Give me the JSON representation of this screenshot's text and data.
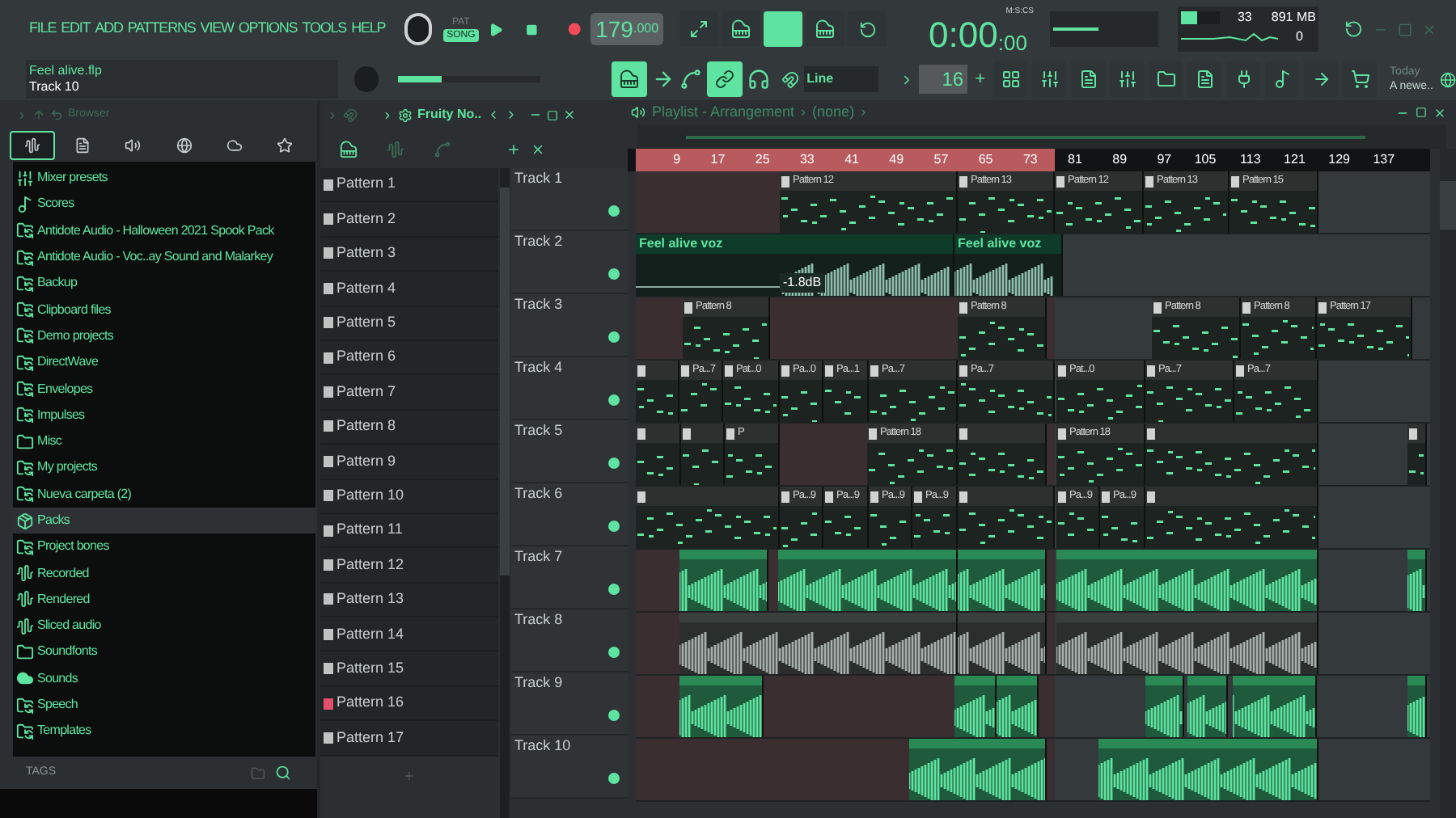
{
  "menu": [
    "FILE",
    "EDIT",
    "ADD",
    "PATTERNS",
    "VIEW",
    "OPTIONS",
    "TOOLS",
    "HELP"
  ],
  "hint": {
    "file": "Feel alive.flp",
    "target": "Track 10"
  },
  "transport": {
    "modes": [
      {
        "label": "PAT",
        "selected": false
      },
      {
        "label": "SONG",
        "selected": true
      }
    ],
    "recording": true,
    "tempo": "179",
    "tempo_fraction": ".000"
  },
  "clock": {
    "time": "0:00",
    "centis": ":00",
    "format": "M:S:CS"
  },
  "monitor": {
    "cpu": "33",
    "memory": "891 MB",
    "polyphony": "0",
    "level": 0.45
  },
  "master_volume": {
    "level": 0.3
  },
  "snap": {
    "value": "Line"
  },
  "step": {
    "value": "16",
    "plus": "+"
  },
  "news": {
    "date": "Today",
    "headline": "A newe.."
  },
  "browser": {
    "title": "Browser",
    "tabs": [
      {
        "selected": true
      },
      {
        "selected": false
      },
      {
        "selected": false
      },
      {
        "selected": false
      },
      {
        "selected": false
      },
      {
        "selected": false
      }
    ],
    "items": [
      {
        "label": "Mixer presets",
        "kind": "mixer",
        "selected": false
      },
      {
        "label": "Scores",
        "kind": "note",
        "selected": false
      },
      {
        "label": "Antidote Audio - Halloween 2021 Spook Pack",
        "kind": "folder",
        "selected": false
      },
      {
        "label": "Antidote Audio - Voc..ay Sound and Malarkey",
        "kind": "folder",
        "selected": false
      },
      {
        "label": "Backup",
        "kind": "folder",
        "selected": false
      },
      {
        "label": "Clipboard files",
        "kind": "folder",
        "selected": false
      },
      {
        "label": "Demo projects",
        "kind": "folder",
        "selected": false
      },
      {
        "label": "DirectWave",
        "kind": "folder",
        "selected": false
      },
      {
        "label": "Envelopes",
        "kind": "folder",
        "selected": false
      },
      {
        "label": "Impulses",
        "kind": "folder",
        "selected": false
      },
      {
        "label": "Misc",
        "kind": "plain",
        "selected": false
      },
      {
        "label": "My projects",
        "kind": "folder",
        "selected": false
      },
      {
        "label": "Nueva carpeta (2)",
        "kind": "folder",
        "selected": false
      },
      {
        "label": "Packs",
        "kind": "packs",
        "selected": true
      },
      {
        "label": "Project bones",
        "kind": "folder",
        "selected": false
      },
      {
        "label": "Recorded",
        "kind": "wave",
        "selected": false
      },
      {
        "label": "Rendered",
        "kind": "wave",
        "selected": false
      },
      {
        "label": "Sliced audio",
        "kind": "wave",
        "selected": false
      },
      {
        "label": "Soundfonts",
        "kind": "plain",
        "selected": false
      },
      {
        "label": "Sounds",
        "kind": "cloud",
        "selected": false
      },
      {
        "label": "Speech",
        "kind": "folder",
        "selected": false
      },
      {
        "label": "Templates",
        "kind": "folder",
        "selected": false
      }
    ],
    "tags": "TAGS"
  },
  "channel_rack": {
    "title": "Fruity No.."
  },
  "patterns": [
    {
      "label": "Pattern 1",
      "selected": false
    },
    {
      "label": "Pattern 2",
      "selected": false
    },
    {
      "label": "Pattern 3",
      "selected": false
    },
    {
      "label": "Pattern 4",
      "selected": false
    },
    {
      "label": "Pattern 5",
      "selected": false
    },
    {
      "label": "Pattern 6",
      "selected": false
    },
    {
      "label": "Pattern 7",
      "selected": false
    },
    {
      "label": "Pattern 8",
      "selected": false
    },
    {
      "label": "Pattern 9",
      "selected": false
    },
    {
      "label": "Pattern 10",
      "selected": false
    },
    {
      "label": "Pattern 11",
      "selected": false
    },
    {
      "label": "Pattern 12",
      "selected": false
    },
    {
      "label": "Pattern 13",
      "selected": false
    },
    {
      "label": "Pattern 14",
      "selected": false
    },
    {
      "label": "Pattern 15",
      "selected": false
    },
    {
      "label": "Pattern 16",
      "selected": true
    },
    {
      "label": "Pattern 17",
      "selected": false
    }
  ],
  "playlist": {
    "title": "Playlist - Arrangement",
    "sep": "›",
    "arrangement": "(none)",
    "sep2": "›",
    "ruler": [
      "9",
      "17",
      "25",
      "33",
      "41",
      "49",
      "57",
      "65",
      "73",
      "81",
      "89",
      "97",
      "105",
      "113",
      "121",
      "129",
      "137"
    ],
    "tracks": [
      {
        "name": "Track 1",
        "enabled": true,
        "clips": [
          {
            "kind": "pattern",
            "label": "Pattern 12"
          },
          {
            "kind": "pattern",
            "label": "Pattern 13"
          },
          {
            "kind": "pattern",
            "label": "Pattern 12"
          },
          {
            "kind": "pattern",
            "label": "Pattern 13"
          },
          {
            "kind": "pattern",
            "label": "Pattern 15"
          }
        ]
      },
      {
        "name": "Track 2",
        "enabled": true,
        "clips": [
          {
            "kind": "vocal",
            "label": "Feel alive voz",
            "gain": "-1.8dB"
          },
          {
            "kind": "vocal",
            "label": "Feel alive voz"
          }
        ]
      },
      {
        "name": "Track 3",
        "enabled": true,
        "clips": [
          {
            "kind": "pattern",
            "label": "Pattern 8"
          },
          {
            "kind": "pattern",
            "label": "Pattern 8"
          },
          {
            "kind": "pattern",
            "label": "Pattern 8"
          },
          {
            "kind": "pattern",
            "label": "Pattern 8"
          },
          {
            "kind": "pattern",
            "label": "Pattern 17"
          }
        ]
      },
      {
        "name": "Track 4",
        "enabled": true,
        "clips": [
          {
            "kind": "pattern"
          },
          {
            "kind": "pattern",
            "label": "Pa...7"
          },
          {
            "kind": "pattern",
            "label": "Pat...0"
          },
          {
            "kind": "pattern",
            "label": "Pa...0"
          },
          {
            "kind": "pattern",
            "label": "Pa...1"
          },
          {
            "kind": "pattern",
            "label": "Pa...7"
          },
          {
            "kind": "pattern",
            "label": "Pa...7"
          },
          {
            "kind": "pattern",
            "label": "Pat...0"
          },
          {
            "kind": "pattern",
            "label": "Pa...7"
          },
          {
            "kind": "pattern",
            "label": "Pa...7"
          }
        ]
      },
      {
        "name": "Track 5",
        "enabled": true,
        "clips": [
          {
            "kind": "pattern"
          },
          {
            "kind": "pattern"
          },
          {
            "kind": "pattern",
            "label": "P"
          },
          {
            "kind": "pattern",
            "label": "Pattern 18"
          },
          {
            "kind": "pattern"
          },
          {
            "kind": "pattern",
            "label": "Pattern 18"
          },
          {
            "kind": "pattern"
          },
          {
            "kind": "pattern"
          }
        ]
      },
      {
        "name": "Track 6",
        "enabled": true,
        "clips": [
          {
            "kind": "pattern"
          },
          {
            "kind": "pattern",
            "label": "Pa...9"
          },
          {
            "kind": "pattern",
            "label": "Pa...9"
          },
          {
            "kind": "pattern",
            "label": "Pa...9"
          },
          {
            "kind": "pattern",
            "label": "Pa...9"
          },
          {
            "kind": "pattern"
          },
          {
            "kind": "pattern",
            "label": "Pa...9"
          },
          {
            "kind": "pattern",
            "label": "Pa...9"
          },
          {
            "kind": "pattern"
          }
        ]
      },
      {
        "name": "Track 7",
        "enabled": true,
        "clips": [
          {
            "kind": "audio"
          },
          {
            "kind": "audio"
          },
          {
            "kind": "audio"
          },
          {
            "kind": "audio"
          },
          {
            "kind": "audio"
          }
        ]
      },
      {
        "name": "Track 8",
        "enabled": true,
        "clips": [
          {
            "kind": "muted"
          },
          {
            "kind": "muted"
          },
          {
            "kind": "muted"
          }
        ]
      },
      {
        "name": "Track 9",
        "enabled": true,
        "clips": [
          {
            "kind": "audio"
          },
          {
            "kind": "audio"
          },
          {
            "kind": "audio"
          },
          {
            "kind": "audio"
          },
          {
            "kind": "audio"
          },
          {
            "kind": "audio"
          },
          {
            "kind": "audio"
          }
        ]
      },
      {
        "name": "Track 10",
        "enabled": true,
        "clips": [
          {
            "kind": "audio"
          },
          {
            "kind": "audio"
          }
        ]
      }
    ]
  }
}
